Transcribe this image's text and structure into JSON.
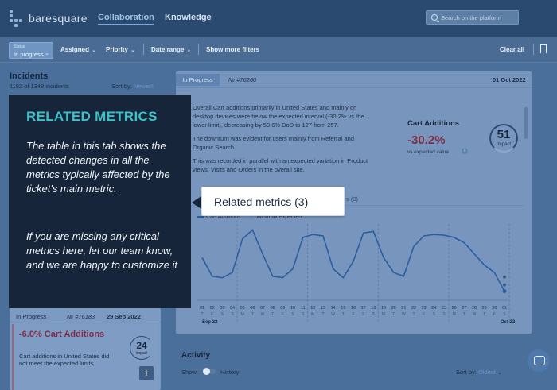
{
  "nav": {
    "brand": "baresquare",
    "collaboration": "Collaboration",
    "knowledge": "Knowledge",
    "search_placeholder": "Search on the platform"
  },
  "filters": {
    "status_label": "Status",
    "status_value": "In progress",
    "assigned": "Assigned",
    "priority": "Priority",
    "date_range": "Date range",
    "show_more": "Show more filters",
    "clear_all": "Clear all"
  },
  "incidents": {
    "title": "Incidents",
    "count": "1182 of 1348 incidents",
    "sort_by_label": "Sort by:",
    "sort_by_value": "Newest",
    "card": {
      "status": "In Progress",
      "id": "№ #76183",
      "date": "29 Sep 2022",
      "metric_change": "-6.0% Cart Additions",
      "description": "Cart additions in United States did not meet the expected limits",
      "impact_value": "24",
      "impact_label": "Impact"
    }
  },
  "ticket": {
    "status": "In Progress",
    "id": "№ #76260",
    "date": "01 Oct 2022",
    "summary_1": "Overall Cart additions primarily in United States and mainly on desktop devices were below the expected interval (-30.2% vs the lower limit), decreasing by 50.6% DoD to 127 from 257.",
    "summary_2": "The downturn was evident for users mainly from Referral and Organic Search.",
    "summary_3": "This was recorded in parallel with an expected variation in Product views, Visits and Orders in the overall site.",
    "metric_title": "Cart Additions",
    "metric_value": "-30.2%",
    "metric_sub": "vs expected value",
    "impact_value": "51",
    "impact_label": "Impact",
    "tab_fragment": "s (9)",
    "legend_series": "Cart Additions",
    "legend_band": "Min/max expected"
  },
  "chart_data": {
    "type": "line",
    "x": [
      "01",
      "02",
      "03",
      "04",
      "05",
      "06",
      "07",
      "08",
      "09",
      "10",
      "11",
      "12",
      "13",
      "14",
      "15",
      "16",
      "17",
      "18",
      "19",
      "20",
      "21",
      "22",
      "23",
      "24",
      "25",
      "26",
      "27",
      "28",
      "29",
      "30",
      "01"
    ],
    "x_weekday_labels": [
      "T",
      "F",
      "S",
      "S",
      "M",
      "T",
      "W",
      "T",
      "F",
      "S",
      "S",
      "M",
      "T",
      "W",
      "T",
      "F",
      "S",
      "S",
      "M",
      "T",
      "W",
      "T",
      "F",
      "S",
      "S",
      "M",
      "T",
      "W",
      "T",
      "F",
      "S"
    ],
    "series": [
      {
        "name": "Cart Additions",
        "values": [
          55,
          30,
          28,
          35,
          80,
          92,
          60,
          30,
          28,
          40,
          82,
          86,
          84,
          40,
          28,
          50,
          88,
          90,
          55,
          35,
          30,
          70,
          84,
          86,
          85,
          82,
          75,
          60,
          45,
          35,
          10
        ]
      }
    ],
    "ylim": [
      0,
      100
    ],
    "start_label": "Sep 22",
    "end_label": "Oct 22"
  },
  "activity": {
    "title": "Activity",
    "show_label": "Show:",
    "history": "History",
    "sort_by_label": "Sort by:",
    "sort_by_value": "Oldest"
  },
  "tooltip": {
    "title": "RELATED METRICS",
    "body_1": "The table in this tab shows the detected changes in all the metrics typically affected by the ticket's main metric.",
    "body_2": "If you are missing any critical metrics here, let our team know, and we are happy to customize it",
    "callout": "Related metrics (3)"
  }
}
